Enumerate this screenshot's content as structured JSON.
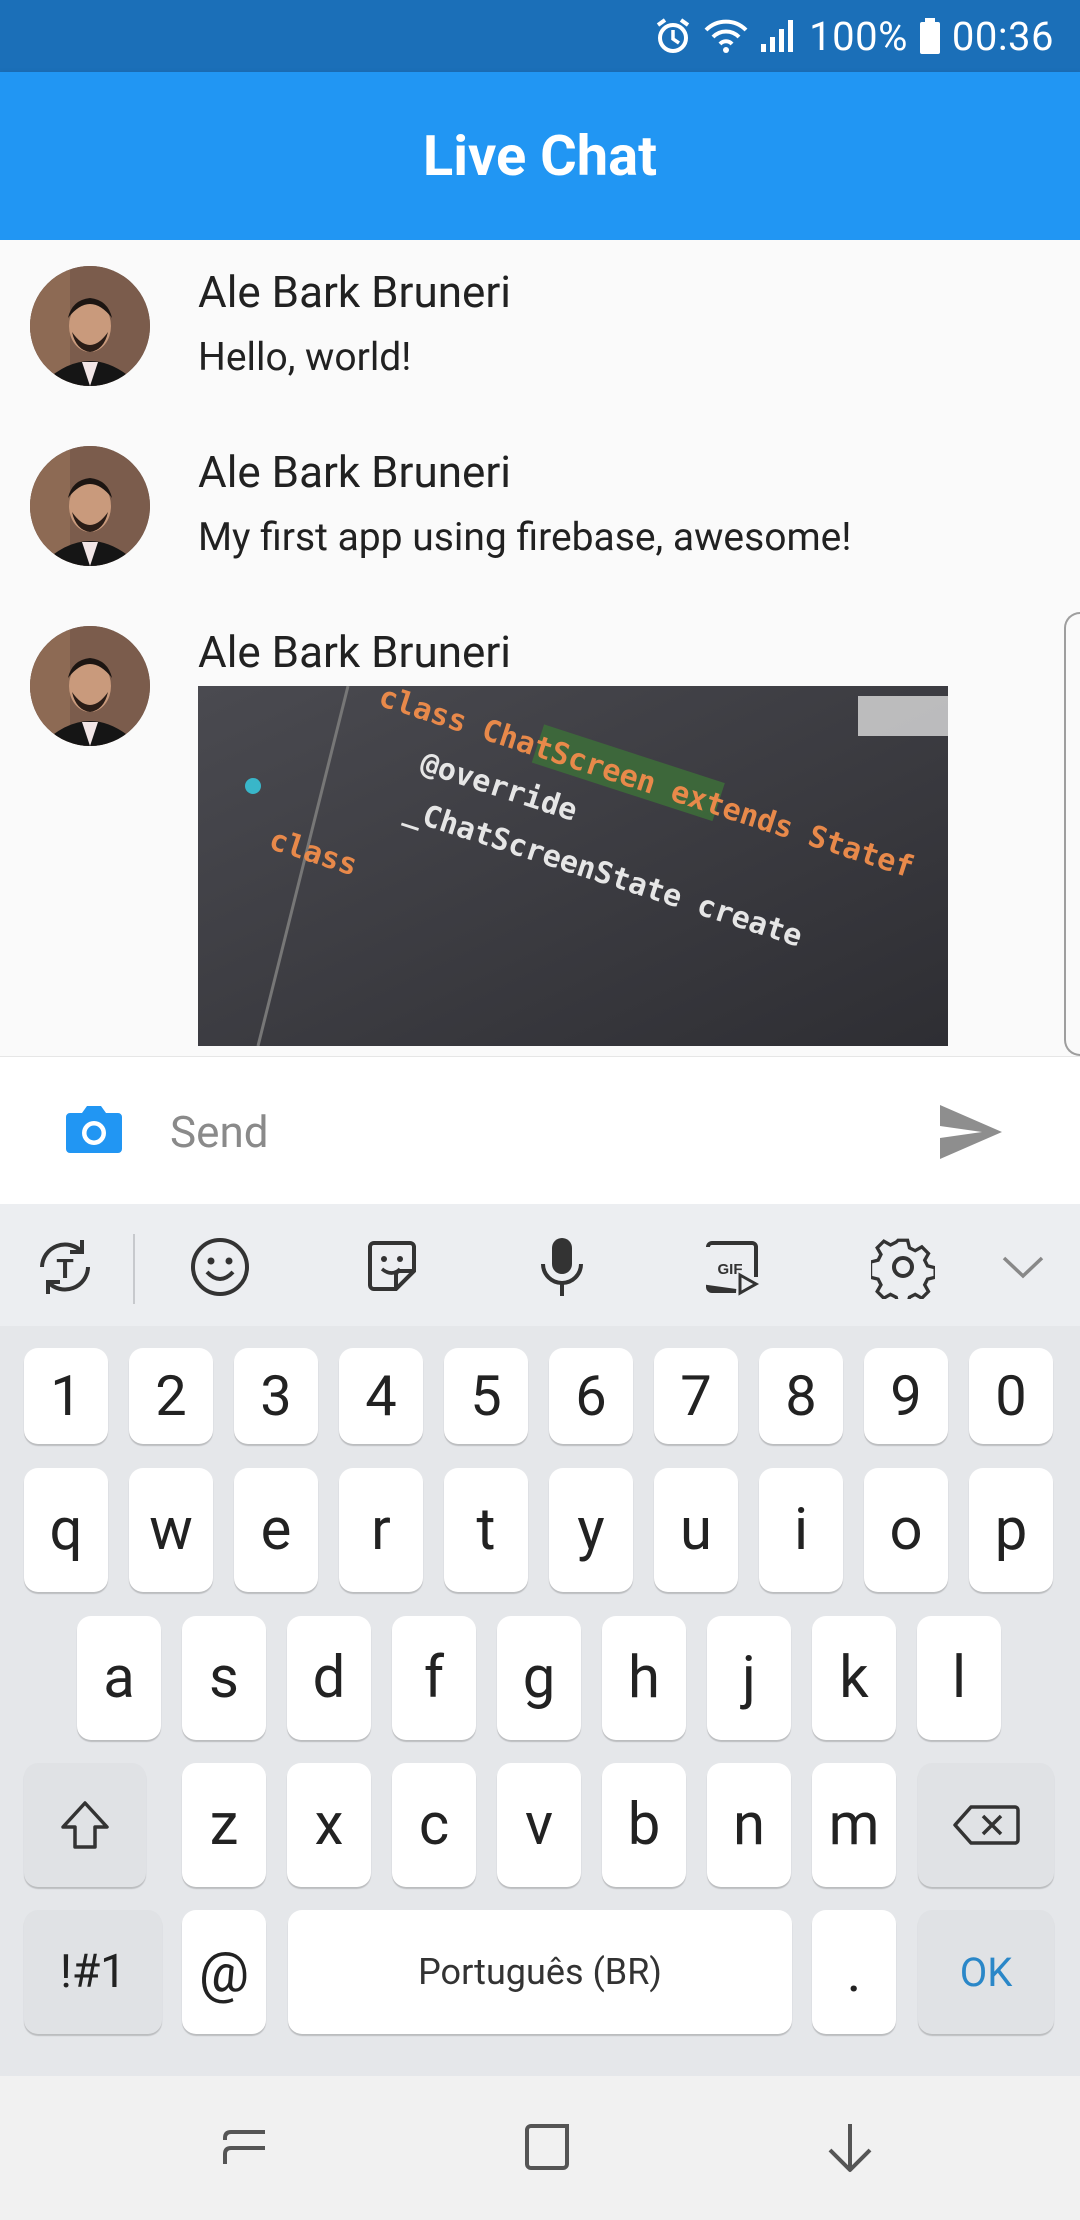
{
  "status_bar": {
    "battery": "100%",
    "time": "00:36"
  },
  "app_bar": {
    "title": "Live Chat"
  },
  "messages": [
    {
      "sender": "Ale Bark Bruneri",
      "text": "Hello, world!"
    },
    {
      "sender": "Ale Bark Bruneri",
      "text": "My first app using firebase, awesome!"
    },
    {
      "sender": "Ale Bark Bruneri",
      "image_code_lines": [
        "class ChatScreen extends Statef",
        "@override",
        "_ChatScreenState create",
        "class"
      ]
    }
  ],
  "composer": {
    "placeholder": "Send"
  },
  "keyboard_toolbar": {
    "gif_label": "GIF"
  },
  "keyboard": {
    "number_row": [
      "1",
      "2",
      "3",
      "4",
      "5",
      "6",
      "7",
      "8",
      "9",
      "0"
    ],
    "row1": [
      "q",
      "w",
      "e",
      "r",
      "t",
      "y",
      "u",
      "i",
      "o",
      "p"
    ],
    "row2": [
      "a",
      "s",
      "d",
      "f",
      "g",
      "h",
      "j",
      "k",
      "l"
    ],
    "row3": [
      "z",
      "x",
      "c",
      "v",
      "b",
      "n",
      "m"
    ],
    "symbols_label": "!#1",
    "at_label": "@",
    "space_label": "Português (BR)",
    "period_label": ".",
    "ok_label": "OK"
  },
  "colors": {
    "primary": "#2196f3",
    "status_bar": "#1b6fb8",
    "ok_text": "#2a87c8"
  }
}
